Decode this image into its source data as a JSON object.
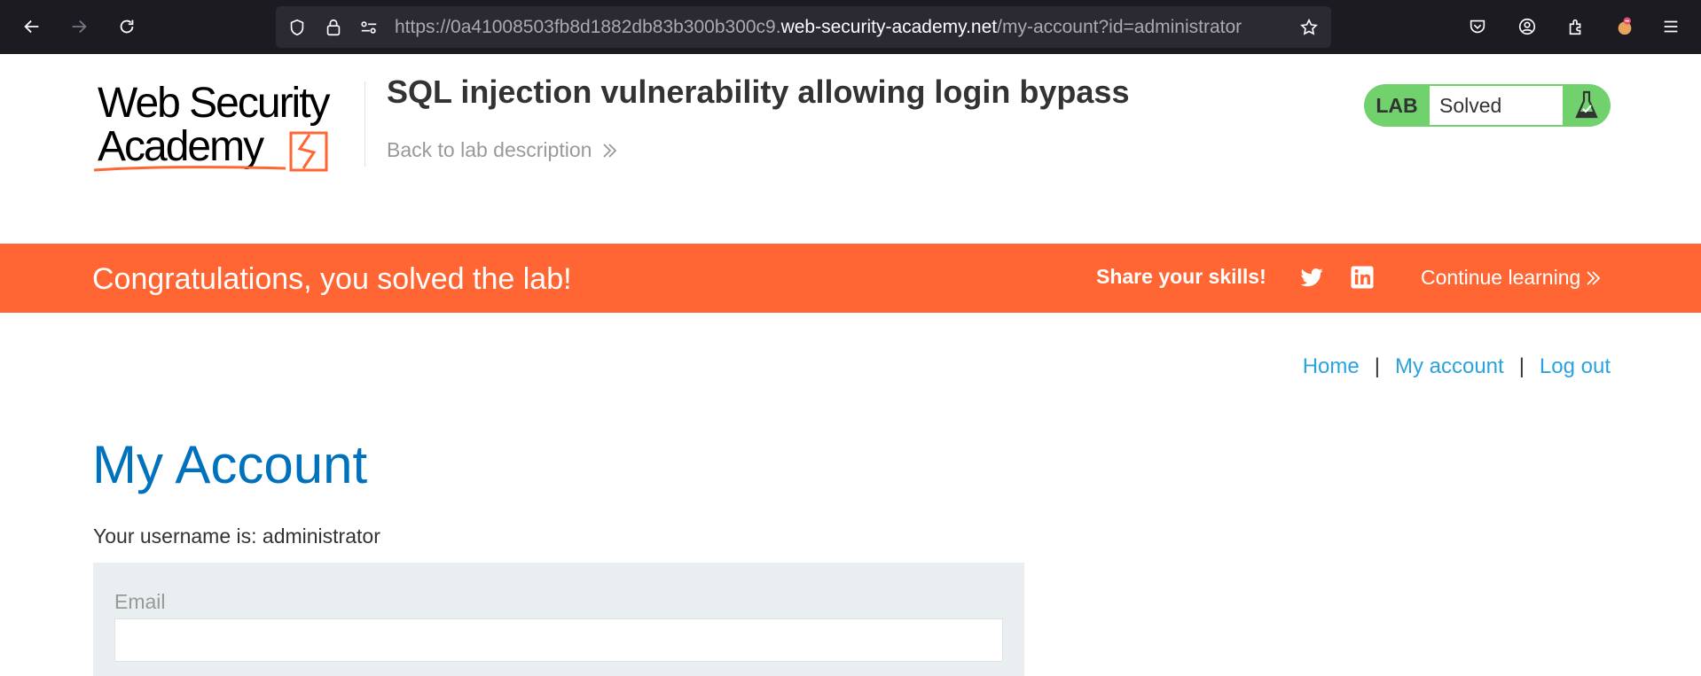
{
  "browser": {
    "url_prefix": "https://0a41008503fb8d1882db83b300b300c9.",
    "url_domain": "web-security-academy.net",
    "url_path": "/my-account?id=administrator"
  },
  "header": {
    "logo_text": "Web Security Academy",
    "lab_title": "SQL injection vulnerability allowing login bypass",
    "back_link": "Back to lab description",
    "lab_badge": "LAB",
    "lab_state": "Solved"
  },
  "banner": {
    "congrats": "Congratulations, you solved the lab!",
    "share": "Share your skills!",
    "continue": "Continue learning"
  },
  "nav": {
    "home": "Home",
    "my_account": "My account",
    "log_out": "Log out",
    "separator": "|"
  },
  "main": {
    "heading": "My Account",
    "username_line": "Your username is: administrator",
    "email_label": "Email",
    "email_value": ""
  },
  "colors": {
    "accent_orange": "#ff6633",
    "lab_green": "#70d16d",
    "link_blue": "#29a3e0",
    "heading_blue": "#0071bc"
  }
}
